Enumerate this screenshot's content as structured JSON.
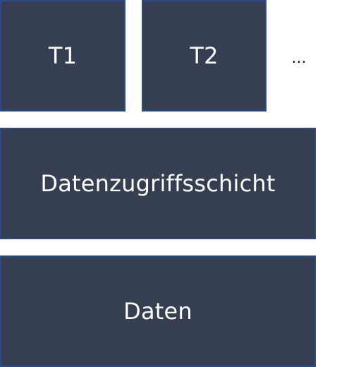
{
  "colors": {
    "box_fill": "#353f51",
    "box_border": "#2b4a86",
    "text": "#ffffff"
  },
  "diagram": {
    "top_row": {
      "t1_label": "T1",
      "t2_label": "T2",
      "more_label": "..."
    },
    "access_layer_label": "Datenzugriffsschicht",
    "data_label": "Daten"
  }
}
